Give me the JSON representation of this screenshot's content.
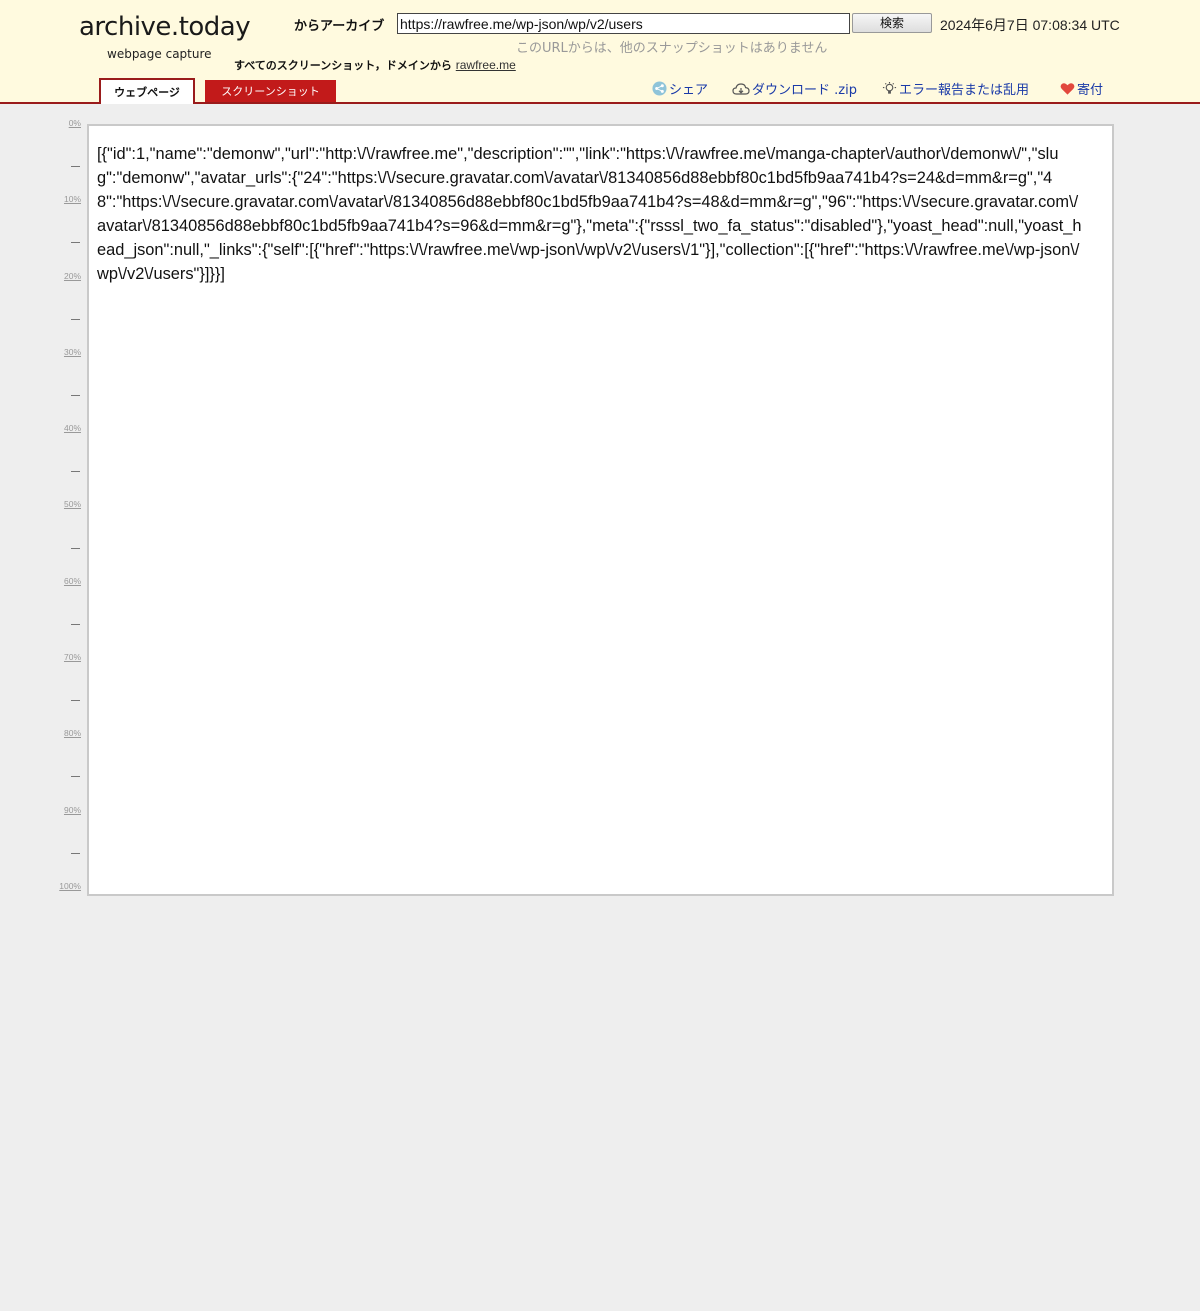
{
  "site": {
    "logo": "archive.today",
    "subtitle": "webpage capture"
  },
  "search": {
    "label": "からアーカイブ",
    "url_value": "https://rawfree.me/wp-json/wp/v2/users",
    "button_label": "検索",
    "timestamp": "2024年6月7日 07:08:34 UTC",
    "no_snapshots_text": "このURLからは、他のスナップショットはありません"
  },
  "screenshots": {
    "label": "すべてのスクリーンショット，ドメインから",
    "domain_link": "rawfree.me"
  },
  "tabs": {
    "webpage": "ウェブページ",
    "screenshot": "スクリーンショット"
  },
  "actions": {
    "share": "シェア",
    "download": "ダウンロード .zip",
    "report": "エラー報告または乱用",
    "donate": "寄付"
  },
  "ruler": {
    "ticks": [
      "0%",
      "10%",
      "20%",
      "30%",
      "40%",
      "50%",
      "60%",
      "70%",
      "80%",
      "90%",
      "100%"
    ]
  },
  "page": {
    "content": "[{\"id\":1,\"name\":\"demonw\",\"url\":\"http:\\/\\/rawfree.me\",\"description\":\"\",\"link\":\"https:\\/\\/rawfree.me\\/manga-chapter\\/author\\/demonw\\/\",\"slug\":\"demonw\",\"avatar_urls\":{\"24\":\"https:\\/\\/secure.gravatar.com\\/avatar\\/81340856d88ebbf80c1bd5fb9aa741b4?s=24&d=mm&r=g\",\"48\":\"https:\\/\\/secure.gravatar.com\\/avatar\\/81340856d88ebbf80c1bd5fb9aa741b4?s=48&d=mm&r=g\",\"96\":\"https:\\/\\/secure.gravatar.com\\/avatar\\/81340856d88ebbf80c1bd5fb9aa741b4?s=96&d=mm&r=g\"},\"meta\":{\"rsssl_two_fa_status\":\"disabled\"},\"yoast_head\":null,\"yoast_head_json\":null,\"_links\":{\"self\":[{\"href\":\"https:\\/\\/rawfree.me\\/wp-json\\/wp\\/v2\\/users\\/1\"}],\"collection\":[{\"href\":\"https:\\/\\/rawfree.me\\/wp-json\\/wp\\/v2\\/users\"}]}}]"
  },
  "colors": {
    "header_bg": "#fffadf",
    "accent": "#9a1b1b",
    "tab_active": "#c21a1a",
    "link": "#1a3aa8"
  }
}
